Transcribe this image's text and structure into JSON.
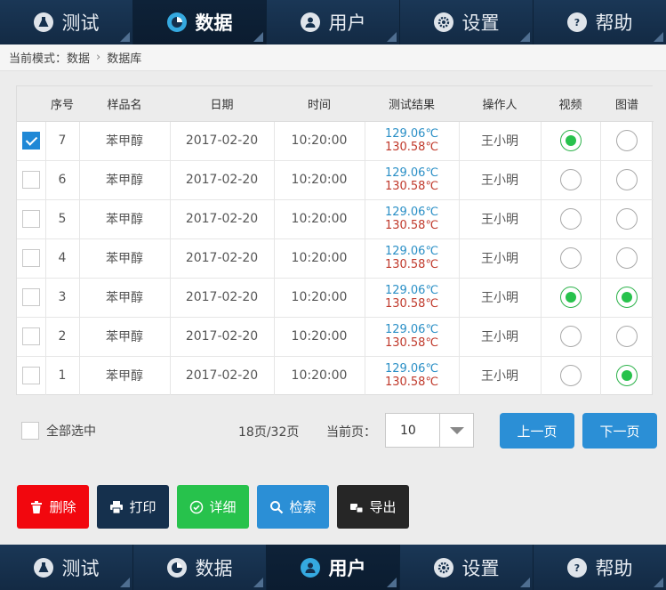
{
  "nav": {
    "tabs": [
      {
        "label": "测试",
        "icon": "flask-icon"
      },
      {
        "label": "数据",
        "icon": "pie-chart-icon"
      },
      {
        "label": "用户",
        "icon": "user-icon"
      },
      {
        "label": "设置",
        "icon": "gear-icon"
      },
      {
        "label": "帮助",
        "icon": "help-icon"
      }
    ],
    "top_active": 1,
    "bottom_active": 2
  },
  "breadcrumb": {
    "mode": "当前模式：数据",
    "current": "数据库"
  },
  "table": {
    "headers": [
      "",
      "序号",
      "样品名",
      "日期",
      "时间",
      "测试结果",
      "操作人",
      "视频",
      "图谱"
    ],
    "rows": [
      {
        "checked": true,
        "no": "7",
        "sample": "苯甲醇",
        "date": "2017-02-20",
        "time": "10:20:00",
        "result_a": "129.06℃",
        "result_b": "130.58℃",
        "operator": "王小明",
        "video": true,
        "spectrum": false
      },
      {
        "checked": false,
        "no": "6",
        "sample": "苯甲醇",
        "date": "2017-02-20",
        "time": "10:20:00",
        "result_a": "129.06℃",
        "result_b": "130.58℃",
        "operator": "王小明",
        "video": false,
        "spectrum": false
      },
      {
        "checked": false,
        "no": "5",
        "sample": "苯甲醇",
        "date": "2017-02-20",
        "time": "10:20:00",
        "result_a": "129.06℃",
        "result_b": "130.58℃",
        "operator": "王小明",
        "video": false,
        "spectrum": false
      },
      {
        "checked": false,
        "no": "4",
        "sample": "苯甲醇",
        "date": "2017-02-20",
        "time": "10:20:00",
        "result_a": "129.06℃",
        "result_b": "130.58℃",
        "operator": "王小明",
        "video": false,
        "spectrum": false
      },
      {
        "checked": false,
        "no": "3",
        "sample": "苯甲醇",
        "date": "2017-02-20",
        "time": "10:20:00",
        "result_a": "129.06℃",
        "result_b": "130.58℃",
        "operator": "王小明",
        "video": true,
        "spectrum": true
      },
      {
        "checked": false,
        "no": "2",
        "sample": "苯甲醇",
        "date": "2017-02-20",
        "time": "10:20:00",
        "result_a": "129.06℃",
        "result_b": "130.58℃",
        "operator": "王小明",
        "video": false,
        "spectrum": false
      },
      {
        "checked": false,
        "no": "1",
        "sample": "苯甲醇",
        "date": "2017-02-20",
        "time": "10:20:00",
        "result_a": "129.06℃",
        "result_b": "130.58℃",
        "operator": "王小明",
        "video": false,
        "spectrum": true
      }
    ]
  },
  "pagination": {
    "select_all_label": "全部选中",
    "page_info": "18页/32页",
    "current_label": "当前页：",
    "current_value": "10",
    "prev_label": "上一页",
    "next_label": "下一页"
  },
  "actions": {
    "delete": {
      "label": "删除",
      "icon": "trash-icon",
      "color": "#f2070e"
    },
    "print": {
      "label": "打印",
      "icon": "printer-icon",
      "color": "#15304d"
    },
    "detail": {
      "label": "详细",
      "icon": "check-circle-icon",
      "color": "#27c24c"
    },
    "search": {
      "label": "检索",
      "icon": "search-icon",
      "color": "#2b8fd6"
    },
    "export": {
      "label": "导出",
      "icon": "export-icon",
      "color": "#262626"
    }
  }
}
